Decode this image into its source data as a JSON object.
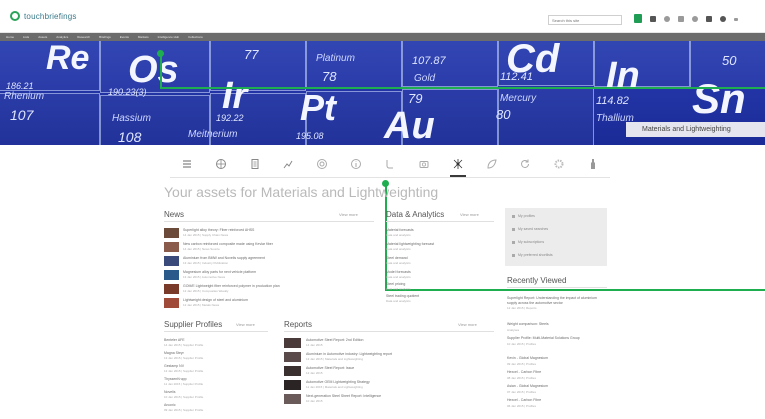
{
  "header": {
    "logo_text": "touchbriefings",
    "search_placeholder": "Search this site",
    "icons": [
      "grid-icon",
      "bell-icon",
      "star-icon",
      "mail-icon",
      "settings-icon",
      "help-icon",
      "user-icon",
      "more-icon"
    ]
  },
  "nav": {
    "items": [
      "Home",
      "Lists",
      "Assets",
      "Analytics",
      "Research",
      "Briefings",
      "Events",
      "Markets",
      "Intelligence Hub",
      "Collections"
    ]
  },
  "hero": {
    "label": "Materials and Lightweighting",
    "elements": [
      {
        "symbol": "Re"
      },
      {
        "symbol": "Os"
      },
      {
        "symbol": "Ir"
      },
      {
        "symbol": "Pt"
      },
      {
        "symbol": "Au"
      },
      {
        "symbol": "Cd"
      },
      {
        "symbol": "In"
      },
      {
        "symbol": "Sn"
      }
    ],
    "numbers": [
      "186.21",
      "190.23(3)",
      "192.22",
      "195.08",
      "77",
      "78",
      "79",
      "80",
      "107.87",
      "112.41",
      "114.82",
      "50",
      "107",
      "108"
    ],
    "words": [
      "Platinum",
      "Gold",
      "Mercury",
      "Thallium",
      "Rhenium",
      "Hassium",
      "Meitnerium"
    ]
  },
  "icon_row": {
    "items": [
      {
        "icon": "list-icon"
      },
      {
        "icon": "globe-icon"
      },
      {
        "icon": "document-icon"
      },
      {
        "icon": "chart-icon"
      },
      {
        "icon": "target-icon"
      },
      {
        "icon": "info-icon"
      },
      {
        "icon": "phone-icon"
      },
      {
        "icon": "camera-icon"
      },
      {
        "icon": "molecule-icon",
        "active": true
      },
      {
        "icon": "leaf-icon"
      },
      {
        "icon": "refresh-icon"
      },
      {
        "icon": "gear-icon"
      },
      {
        "icon": "bottle-icon"
      }
    ]
  },
  "page_heading": "Your assets for Materials and Lightweighting",
  "news": {
    "title": "News",
    "view_more": "View more",
    "items": [
      {
        "title": "Superlight alloy theory: Fiber reinforced AHSS",
        "meta": "14 Jan 2015 | Supply Chain News",
        "thumb_color": "#6b4a3a"
      },
      {
        "title": "New carbon reinforced composite made using Kevlar fiber",
        "meta": "14 Jan 2015 | News Source",
        "thumb_color": "#8a5a4a"
      },
      {
        "title": "Aluminium from BMW and Novelis supply agreement",
        "meta": "13 Jan 2015 | Industry Publication",
        "thumb_color": "#3a4a7a"
      },
      {
        "title": "Magnesium alloy parts for next vehicle platform",
        "meta": "13 Jan 2015 | Automotive News",
        "thumb_color": "#2a5a8a"
      },
      {
        "title": "GOM/E Lightweight fiber reinforced polymer in production plan",
        "meta": "12 Jan 2015 | Composites Weekly",
        "thumb_color": "#7a3a2a"
      },
      {
        "title": "Lightweight design of steel and aluminium",
        "meta": "12 Jan 2015 | Metals News",
        "thumb_color": "#a04a3a"
      }
    ]
  },
  "data_analytics": {
    "title": "Data & Analytics",
    "view_more": "View more",
    "items": [
      {
        "title": "Material forecasts",
        "meta": "Data and analytics"
      },
      {
        "title": "Material lightweighting forecast",
        "meta": "Data and analytics"
      },
      {
        "title": "Steel demand",
        "meta": "Data and analytics"
      },
      {
        "title": "Model forecasts",
        "meta": "Data and analytics"
      },
      {
        "title": "Steel pricing",
        "meta": "Data and analytics"
      },
      {
        "title": "Steel trading quotient",
        "meta": "Data and analytics"
      }
    ]
  },
  "shortcuts": {
    "items": [
      "My profiles",
      "My saved searches",
      "My subscriptions",
      "My preferred shortlists"
    ]
  },
  "recently_viewed": {
    "title": "Recently Viewed",
    "items": [
      {
        "title": "Superlight Report: Understanding the impact of aluminium supply across the automotive sector",
        "meta": "12 Jan 2015 | Reports"
      },
      {
        "title": "Weight comparison: Steels",
        "meta": "Analyses"
      },
      {
        "title": "Supplier Profile: Multi-Material Solutions Group",
        "meta": "10 Jan 2015 | Profiles"
      },
      {
        "title": "Kevin - Global Magnesium",
        "meta": "09 Jan 2015 | Profiles"
      },
      {
        "title": "Hexcel - Carbon Fibre",
        "meta": "08 Jan 2015 | Profiles"
      },
      {
        "title": "Asian - Global Magnesium",
        "meta": "07 Jan 2015 | Profiles"
      },
      {
        "title": "Hexcel - Carbon Fibre",
        "meta": "06 Jan 2015 | Profiles"
      }
    ]
  },
  "supplier_profiles": {
    "title": "Supplier Profiles",
    "view_more": "View more",
    "items": [
      {
        "title": "Benteler AFE",
        "meta": "14 Jan 2015 | Supplier Profile"
      },
      {
        "title": "Magna Steyr",
        "meta": "13 Jan 2015 | Supplier Profile"
      },
      {
        "title": "Gestamp NV",
        "meta": "12 Jan 2015 | Supplier Profile"
      },
      {
        "title": "ThyssenKrupp",
        "meta": "11 Jan 2015 | Supplier Profile"
      },
      {
        "title": "Novelis",
        "meta": "10 Jan 2015 | Supplier Profile"
      },
      {
        "title": "Arconic",
        "meta": "09 Jan 2015 | Supplier Profile"
      }
    ]
  },
  "reports": {
    "title": "Reports",
    "view_more": "View more",
    "items": [
      {
        "title": "Automotive Steel Report: 2nd Edition",
        "meta": "14 Jan 2015",
        "thumb_color": "#4a3a3a"
      },
      {
        "title": "Aluminium in Automotive industry: Lightweighting report",
        "meta": "13 Jan 2015 | Materials and Lightweighting",
        "thumb_color": "#5a4a4a"
      },
      {
        "title": "Automotive Steel Report: Issue",
        "meta": "12 Jan 2015",
        "thumb_color": "#3a3030"
      },
      {
        "title": "Automotive OEM Lightweighting Strategy",
        "meta": "11 Jan 2015 | Materials and Lightweighting",
        "thumb_color": "#2a2424"
      },
      {
        "title": "Next-generation Steel Sheet Report: Intelligence",
        "meta": "10 Jan 2015",
        "thumb_color": "#6a5a5a"
      }
    ]
  },
  "colors": {
    "accent_green": "#1fae4f",
    "nav_gray": "#6c6c6c",
    "hero_blue": "#2335a6"
  }
}
